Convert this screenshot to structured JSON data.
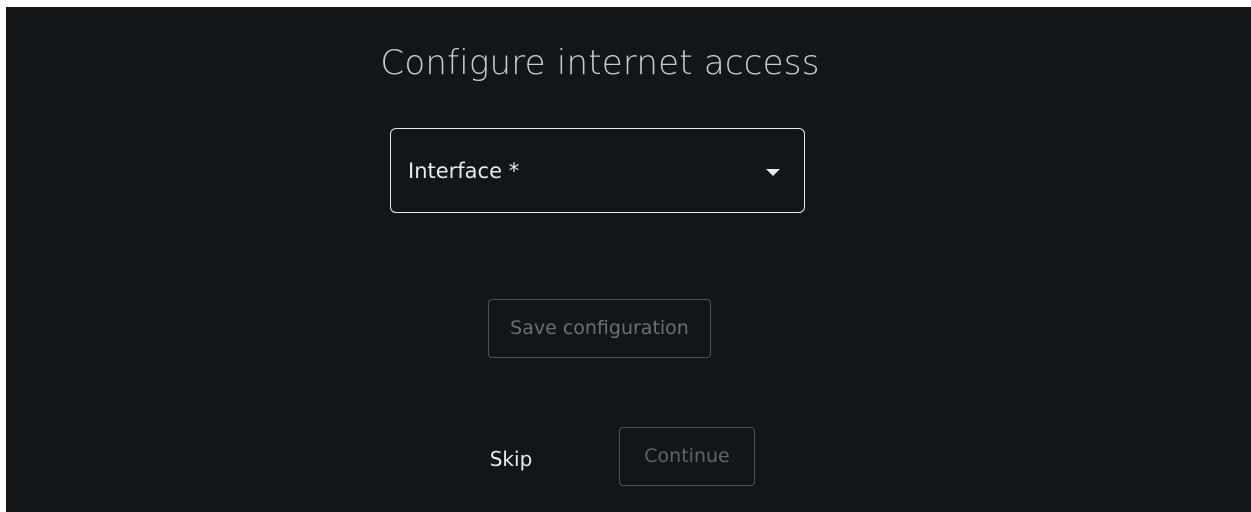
{
  "page": {
    "title": "Configure internet access"
  },
  "interface_select": {
    "label": "Interface *",
    "icon": "caret-down-icon"
  },
  "actions": {
    "save_label": "Save configuration",
    "skip_label": "Skip",
    "continue_label": "Continue"
  },
  "colors": {
    "background": "#121619",
    "text_primary": "#e8eaec",
    "text_disabled": "#6b6f73",
    "border_disabled": "#4f5357"
  }
}
